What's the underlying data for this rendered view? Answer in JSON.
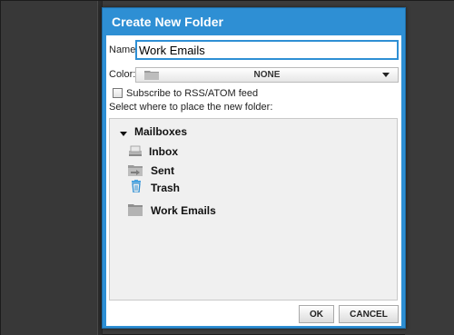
{
  "dialog": {
    "title": "Create New Folder",
    "name_label": "Name:",
    "name_value": "Work Emails",
    "color_label": "Color:",
    "color_value": "NONE",
    "subscribe_label": "Subscribe to RSS/ATOM feed",
    "subscribe_checked": false,
    "placement_label": "Select where to place the new folder:",
    "tree": {
      "root": {
        "label": "Mailboxes",
        "icon": "caret-down-icon",
        "expanded": true
      },
      "items": [
        {
          "label": "Inbox",
          "icon": "inbox-icon"
        },
        {
          "label": "Sent",
          "icon": "sent-folder-icon"
        },
        {
          "label": "Trash",
          "icon": "trash-icon"
        },
        {
          "label": "Work Emails",
          "icon": "folder-icon"
        }
      ]
    },
    "ok_label": "OK",
    "cancel_label": "CANCEL"
  },
  "colors": {
    "dialog_frame": "#2e8fd4",
    "background": "#3c3c3c",
    "tree_background": "#f0f0f0"
  }
}
